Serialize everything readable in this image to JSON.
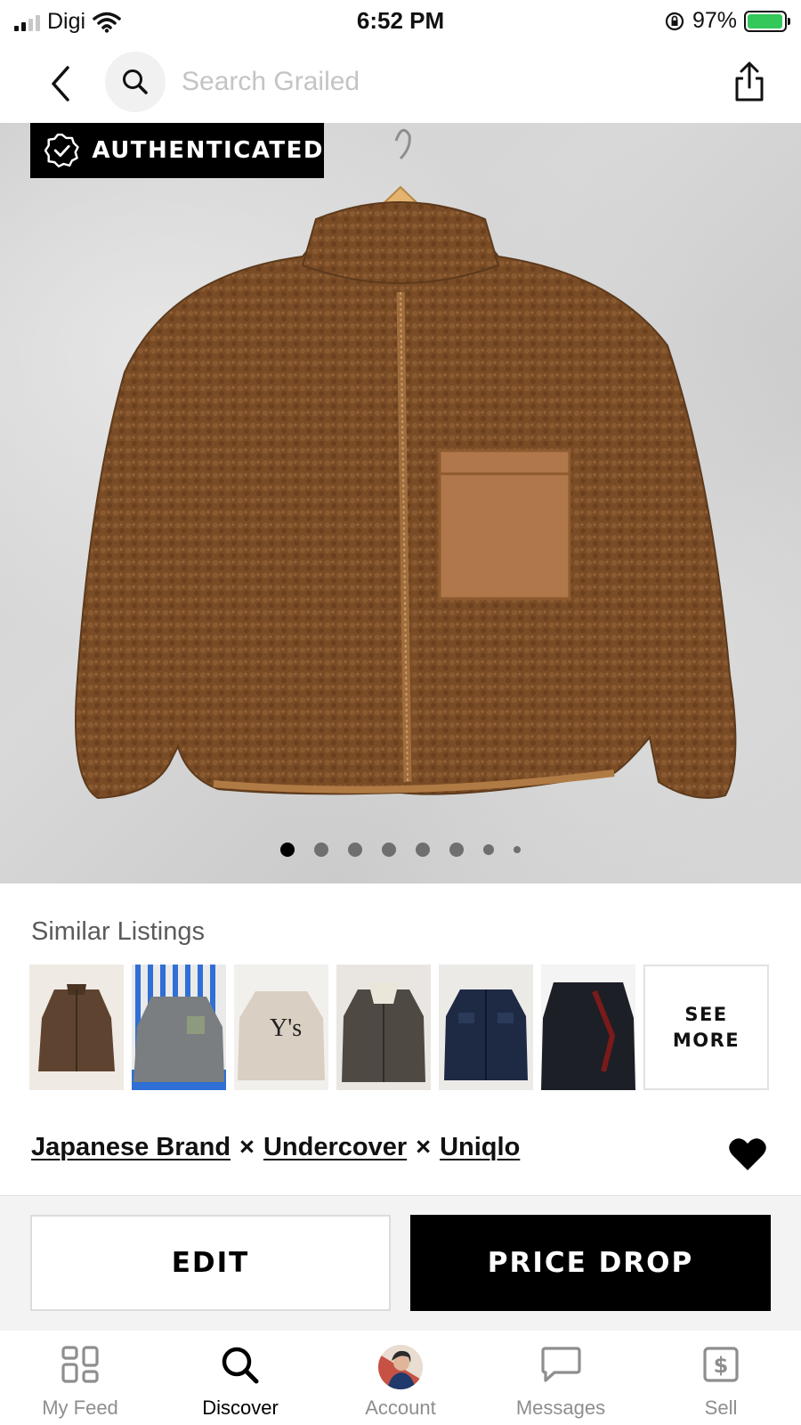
{
  "status_bar": {
    "carrier": "Digi",
    "time": "6:52 PM",
    "battery": "97%"
  },
  "top_nav": {
    "search_placeholder": "Search Grailed"
  },
  "listing": {
    "authenticated_label": "AUTHENTICATED",
    "photo_count": 8,
    "active_photo": 1
  },
  "similar": {
    "title": "Similar Listings",
    "see_more": "SEE MORE"
  },
  "brands": {
    "items": [
      "Japanese Brand",
      "Undercover",
      "Uniqlo"
    ],
    "separator": "×"
  },
  "actions": {
    "edit": "EDIT",
    "price_drop": "PRICE DROP"
  },
  "tabs": [
    {
      "label": "My Feed",
      "icon": "feed-grid-icon"
    },
    {
      "label": "Discover",
      "icon": "search-icon"
    },
    {
      "label": "Account",
      "icon": "avatar"
    },
    {
      "label": "Messages",
      "icon": "chat-bubble-icon"
    },
    {
      "label": "Sell",
      "icon": "dollar-tag-icon"
    }
  ],
  "colors": {
    "accent": "#000000",
    "battery": "#34c759",
    "muted_text": "#8e8e8e"
  }
}
